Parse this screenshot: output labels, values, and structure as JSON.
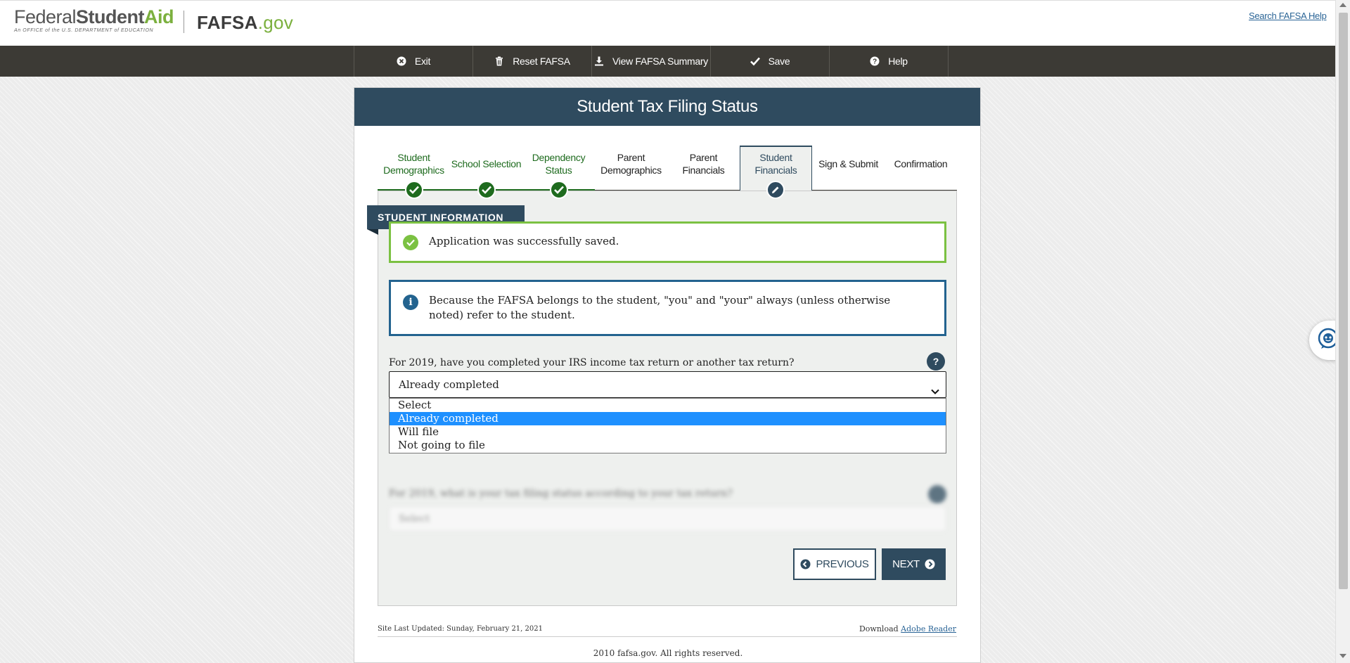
{
  "header": {
    "logo_federal": "Federal",
    "logo_student": "Student",
    "logo_aid": "Aid",
    "logo_tagline": "An OFFICE of the U.S. DEPARTMENT of EDUCATION",
    "logo_fafsa": "FAFSA",
    "logo_gov": ".gov",
    "search_help": "Search FAFSA Help"
  },
  "nav": {
    "items": [
      {
        "label": "Exit",
        "icon": "close-circle-icon"
      },
      {
        "label": "Reset FAFSA",
        "icon": "trash-icon"
      },
      {
        "label": "View FAFSA Summary",
        "icon": "download-icon"
      },
      {
        "label": "Save",
        "icon": "checkmark-icon"
      },
      {
        "label": "Help",
        "icon": "question-circle-icon"
      }
    ]
  },
  "page": {
    "title": "Student Tax Filing Status"
  },
  "progress": {
    "steps": [
      {
        "line1": "Student",
        "line2": "Demographics",
        "state": "done"
      },
      {
        "line1": "School Selection",
        "line2": "",
        "state": "done"
      },
      {
        "line1": "Dependency",
        "line2": "Status",
        "state": "done"
      },
      {
        "line1": "Parent",
        "line2": "Demographics",
        "state": "todo"
      },
      {
        "line1": "Parent",
        "line2": "Financials",
        "state": "todo"
      },
      {
        "line1": "Student",
        "line2": "Financials",
        "state": "active"
      },
      {
        "line1": "Sign & Submit",
        "line2": "",
        "state": "todo"
      },
      {
        "line1": "Confirmation",
        "line2": "",
        "state": "todo"
      }
    ]
  },
  "section": {
    "tab_label": "STUDENT INFORMATION",
    "success_message": "Application was successfully saved.",
    "info_message": "Because the FAFSA belongs to the student, \"you\" and \"your\" always (unless otherwise noted) refer to the student."
  },
  "question1": {
    "label": "For 2019, have you completed your IRS income tax return or another tax return?",
    "help_glyph": "?",
    "selected": "Already completed",
    "options": [
      "Select",
      "Already completed",
      "Will file",
      "Not going to file"
    ]
  },
  "question2": {
    "label": "For 2019, what is your tax filing status according to your tax return?",
    "selected": "Select"
  },
  "buttons": {
    "previous": "PREVIOUS",
    "next": "NEXT"
  },
  "footer": {
    "updated": "Site Last Updated: Sunday, February 21, 2021",
    "download_prefix": "Download ",
    "download_link": "Adobe Reader",
    "copyright": "2010 fafsa.gov. All rights reserved."
  },
  "colors": {
    "brand_dark": "#2f4b5f",
    "nav_bg": "#3c3a35",
    "done_green": "#1e6b1e",
    "success_green": "#7bc142",
    "info_blue": "#23638f",
    "selected_option": "#1e90ff"
  }
}
